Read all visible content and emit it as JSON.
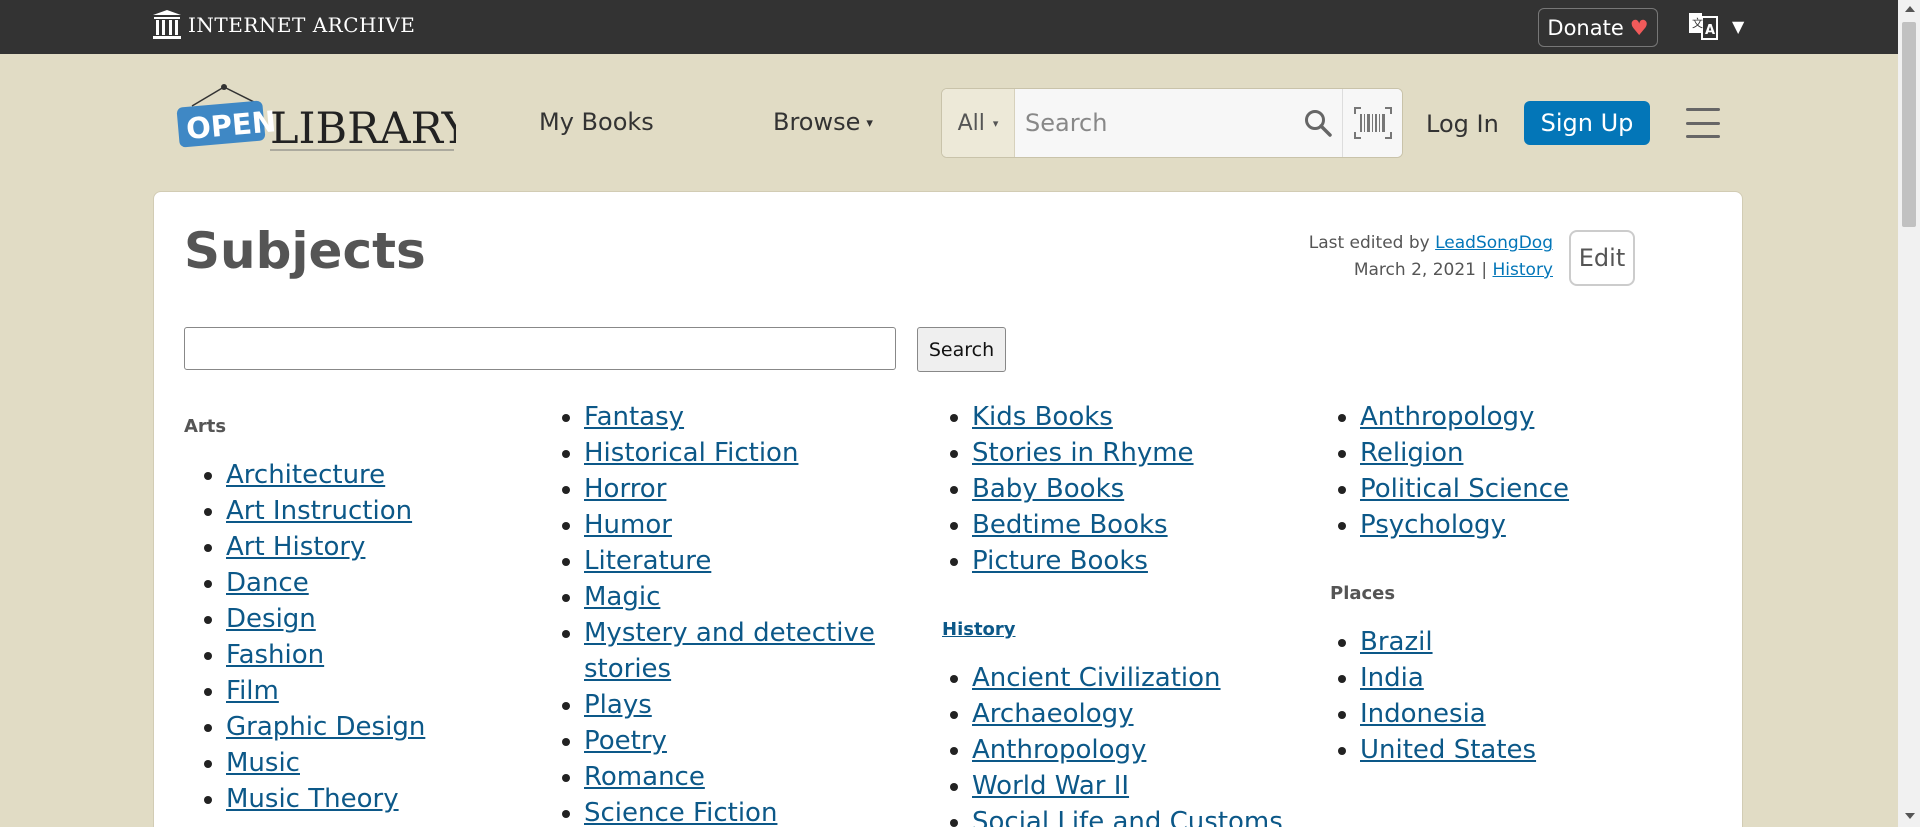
{
  "topbar": {
    "brand": "INTERNET ARCHIVE",
    "donate_label": "Donate",
    "donate_heart": "♥",
    "lang_caret": "▼"
  },
  "header": {
    "logo_open": "OPEN",
    "logo_library": "LIBRARY",
    "nav": {
      "mybooks": "My Books",
      "browse": "Browse",
      "browse_caret": "▾"
    },
    "search": {
      "scope": "All",
      "scope_caret": "▾",
      "placeholder": "Search"
    },
    "login": "Log In",
    "signup": "Sign Up"
  },
  "page": {
    "title": "Subjects",
    "last_edited_prefix": "Last edited by ",
    "last_edited_user": "LeadSongDog",
    "last_edited_date": "March 2, 2021",
    "separator": " | ",
    "history_link": "History",
    "edit_label": "Edit",
    "search_button": "Search"
  },
  "columns": {
    "col1": {
      "heading": "Arts",
      "items": [
        "Architecture",
        "Art Instruction",
        "Art History",
        "Dance",
        "Design",
        "Fashion",
        "Film",
        "Graphic Design",
        "Music",
        "Music Theory"
      ]
    },
    "col2": {
      "items": [
        "Fantasy",
        "Historical Fiction",
        "Horror",
        "Humor",
        "Literature",
        "Magic",
        "Mystery and detective stories",
        "Plays",
        "Poetry",
        "Romance",
        "Science Fiction"
      ]
    },
    "col3": {
      "items": [
        "Kids Books",
        "Stories in Rhyme",
        "Baby Books",
        "Bedtime Books",
        "Picture Books"
      ],
      "heading2": "History",
      "items2": [
        "Ancient Civilization",
        "Archaeology",
        "Anthropology",
        "World War II",
        "Social Life and Customs"
      ]
    },
    "col4": {
      "items": [
        "Anthropology",
        "Religion",
        "Political Science",
        "Psychology"
      ],
      "heading2": "Places",
      "items2": [
        "Brazil",
        "India",
        "Indonesia",
        "United States"
      ]
    }
  },
  "colors": {
    "ia_bar": "#333333",
    "page_bg": "#e1dcc5",
    "signup_blue": "#0376b8",
    "link": "#0c5888"
  }
}
